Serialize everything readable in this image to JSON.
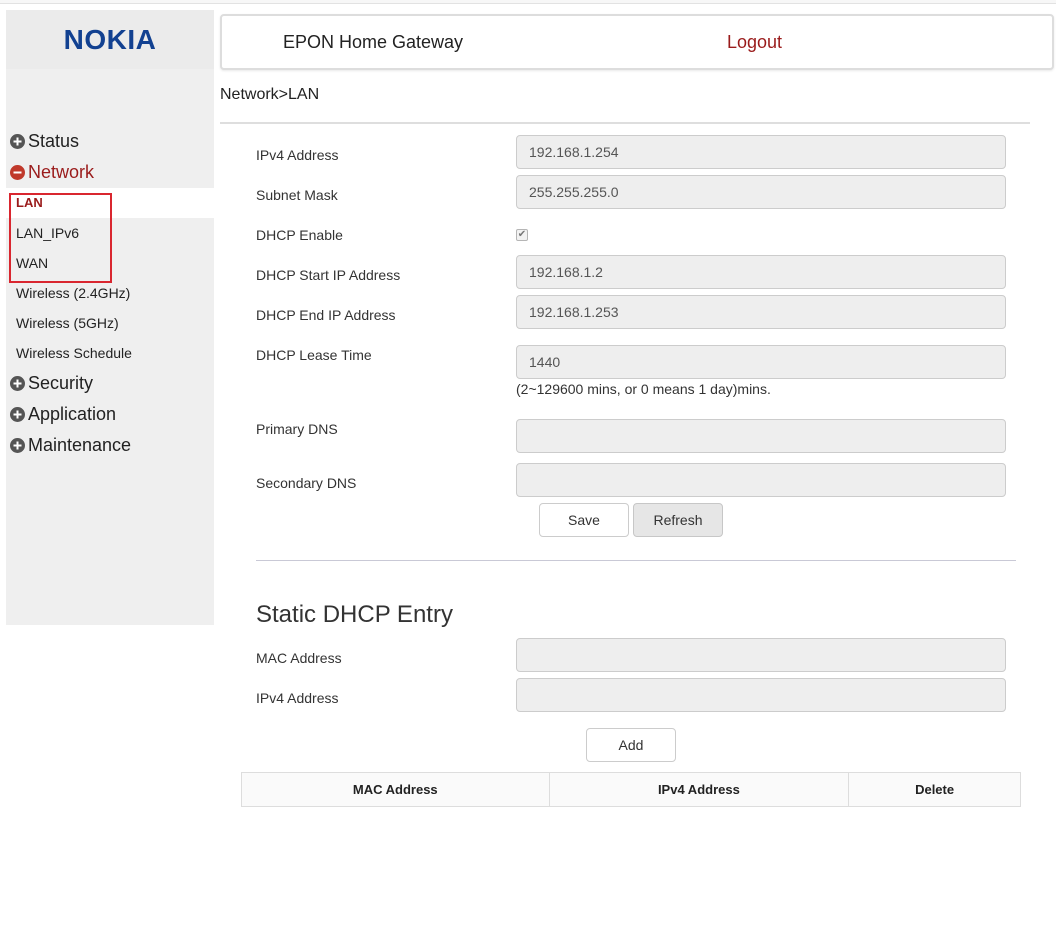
{
  "brand": {
    "logo_text": "NOKIA",
    "logo_color": "#124191"
  },
  "header": {
    "title": "EPON Home Gateway",
    "logout_label": "Logout"
  },
  "breadcrumb": "Network>LAN",
  "sidebar": {
    "groups": [
      {
        "label": "Status",
        "icon": "plus-circle-icon",
        "expanded": false
      },
      {
        "label": "Network",
        "icon": "minus-circle-icon",
        "expanded": true,
        "items": [
          "LAN",
          "LAN_IPv6",
          "WAN",
          "Wireless (2.4GHz)",
          "Wireless (5GHz)",
          "Wireless Schedule"
        ],
        "selected": "LAN"
      },
      {
        "label": "Security",
        "icon": "plus-circle-icon",
        "expanded": false
      },
      {
        "label": "Application",
        "icon": "plus-circle-icon",
        "expanded": false
      },
      {
        "label": "Maintenance",
        "icon": "plus-circle-icon",
        "expanded": false
      }
    ]
  },
  "form": {
    "ipv4_address": {
      "label": "IPv4 Address",
      "value": "192.168.1.254"
    },
    "subnet_mask": {
      "label": "Subnet Mask",
      "value": "255.255.255.0"
    },
    "dhcp_enable": {
      "label": "DHCP Enable",
      "checked": true
    },
    "dhcp_start": {
      "label": "DHCP Start IP Address",
      "value": "192.168.1.2"
    },
    "dhcp_end": {
      "label": "DHCP End IP Address",
      "value": "192.168.1.253"
    },
    "lease_time": {
      "label": "DHCP Lease Time",
      "value": "1440",
      "hint": "(2~129600 mins, or 0 means 1 day)mins."
    },
    "primary_dns": {
      "label": "Primary DNS",
      "value": ""
    },
    "secondary_dns": {
      "label": "Secondary DNS",
      "value": ""
    },
    "save_label": "Save",
    "refresh_label": "Refresh"
  },
  "static_dhcp": {
    "title": "Static DHCP Entry",
    "mac_label": "MAC Address",
    "mac_value": "",
    "ipv4_label": "IPv4 Address",
    "ipv4_value": "",
    "add_label": "Add",
    "columns": [
      "MAC Address",
      "IPv4 Address",
      "Delete"
    ]
  },
  "colors": {
    "accent_red": "#9a1b1b",
    "highlight_red": "#d9262f",
    "sidebar_bg": "#efefef"
  }
}
